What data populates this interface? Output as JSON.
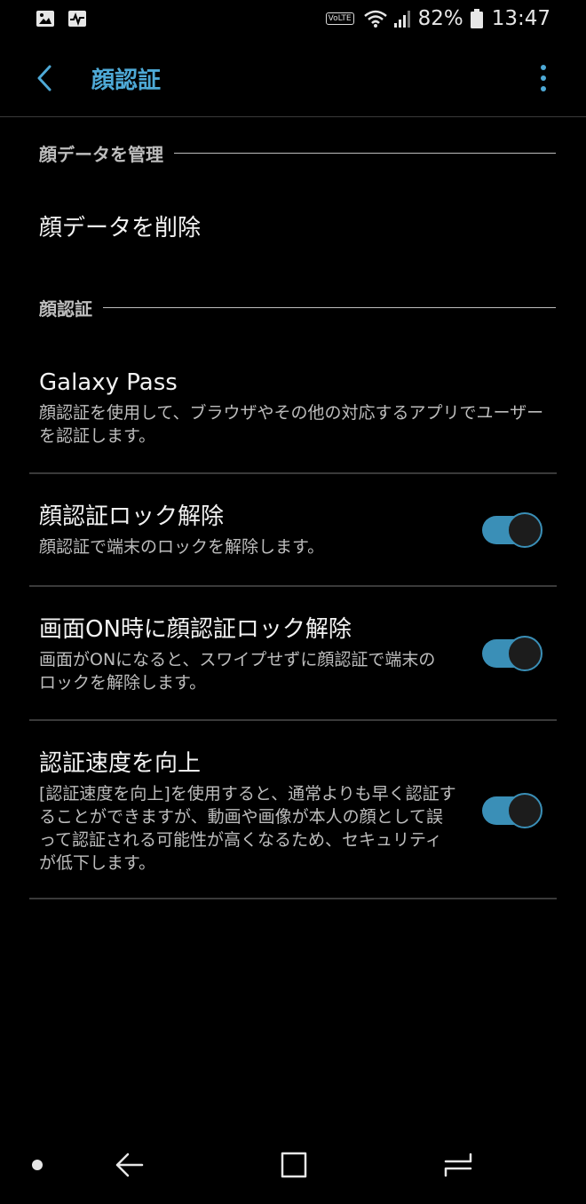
{
  "status_bar": {
    "volte": "VoLTE",
    "battery": "82%",
    "time": "13:47",
    "icons": [
      "image-icon",
      "activity-icon",
      "wifi-icon",
      "signal-icon",
      "battery-icon"
    ]
  },
  "app_bar": {
    "title": "顔認証",
    "accent_color": "#4ea9d6"
  },
  "sections": {
    "manage": {
      "header": "顔データを管理",
      "delete_item": "顔データを削除"
    },
    "face_recognition": {
      "header": "顔認証"
    }
  },
  "items": {
    "galaxy_pass": {
      "title": "Galaxy Pass",
      "desc": "顔認証を使用して、ブラウザやその他の対応するアプリでユーザーを認証します。"
    },
    "face_unlock": {
      "title": "顔認証ロック解除",
      "desc": "顔認証で端末のロックを解除します。",
      "enabled": true
    },
    "screen_on_unlock": {
      "title": "画面ON時に顔認証ロック解除",
      "desc": "画面がONになると、スワイプせずに顔認証で端末のロックを解除します。",
      "enabled": true
    },
    "faster_recognition": {
      "title": "認証速度を向上",
      "desc": "[認証速度を向上]を使用すると、通常よりも早く認証することができますが、動画や画像が本人の顔として誤って認証される可能性が高くなるため、セキュリティが低下します。",
      "enabled": true
    }
  },
  "nav_bar": {
    "icons": [
      "dot-icon",
      "back-arrow-icon",
      "recents-icon",
      "home-icon"
    ]
  }
}
